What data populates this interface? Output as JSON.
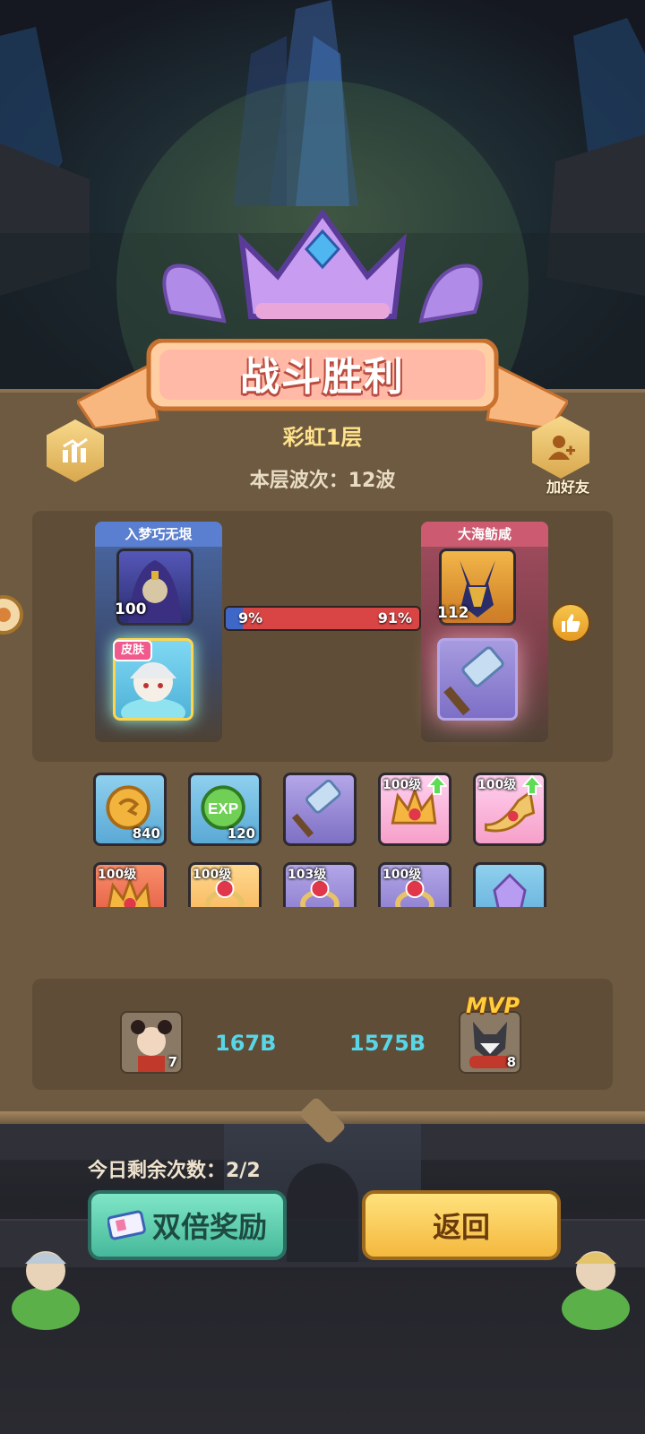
{
  "title_banner": "战斗胜利",
  "stage": {
    "name": "彩虹1层",
    "wave_label": "本层波次：12波"
  },
  "header": {
    "stats_icon": "bar-chart-icon",
    "add_friend_label": "加好友"
  },
  "battle": {
    "left_team": {
      "name": "入梦巧无垠",
      "hero_level": "100",
      "skin_tag": "皮肤"
    },
    "right_team": {
      "name": "大海鲂咸",
      "hero_level": "112"
    },
    "ratio": {
      "left_label": "9%",
      "right_label": "91%",
      "left_fraction": 0.09
    }
  },
  "rewards": [
    {
      "type": "gold-coin",
      "quantity": "840",
      "color": "blue"
    },
    {
      "type": "exp-orb",
      "quantity": "120",
      "color": "blue"
    },
    {
      "type": "hammer",
      "quantity": "",
      "color": "purple"
    },
    {
      "type": "crown",
      "level": "100级",
      "upgrade": true,
      "color": "pink"
    },
    {
      "type": "horn",
      "level": "100级",
      "upgrade": true,
      "color": "pink"
    },
    {
      "type": "crown",
      "level": "100级",
      "color": "red"
    },
    {
      "type": "ring",
      "level": "100级",
      "color": "orange"
    },
    {
      "type": "ring",
      "level": "103级",
      "color": "purple"
    },
    {
      "type": "ring",
      "level": "100级",
      "color": "purple"
    },
    {
      "type": "crystal",
      "level": "",
      "color": "blue"
    }
  ],
  "damage": {
    "left": {
      "avatar_level": "7",
      "value": "167B"
    },
    "right": {
      "avatar_level": "8",
      "value": "1575B",
      "badge": "MVP"
    }
  },
  "footer": {
    "remaining": "今日剩余次数：2/2",
    "double_reward_label": "双倍奖励",
    "return_label": "返回"
  },
  "colors": {
    "panel": "#6e5a41",
    "left_team": "#5b7fd0",
    "right_team": "#cc5b71",
    "damage_text": "#58d6e8",
    "accent_gold": "#ffe28a"
  }
}
